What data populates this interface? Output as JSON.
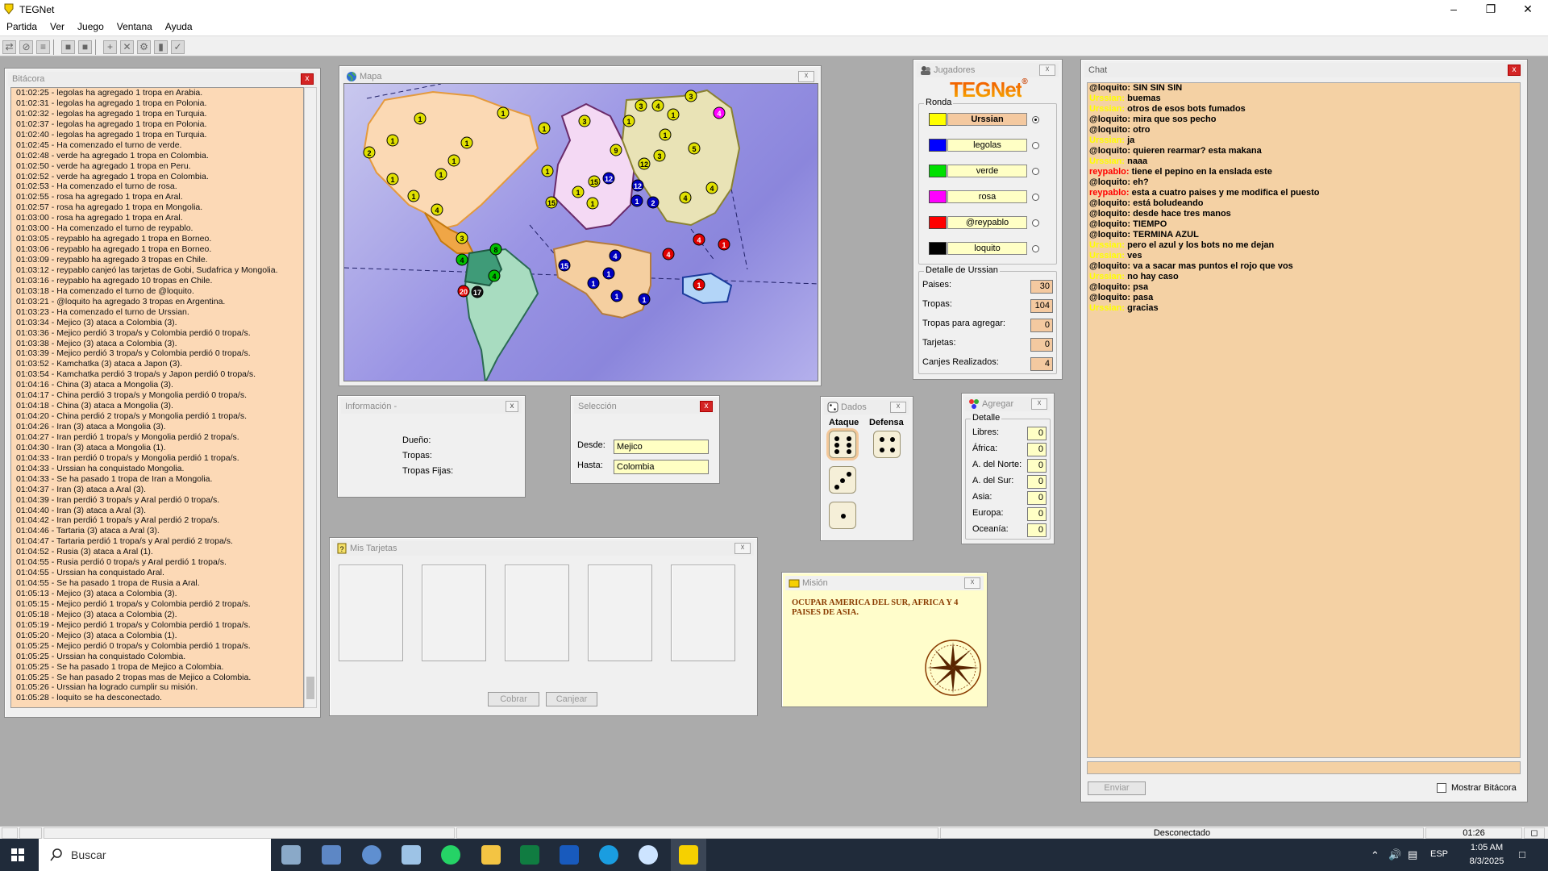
{
  "app": {
    "title": "TEGNet",
    "menu": [
      "Partida",
      "Ver",
      "Juego",
      "Ventana",
      "Ayuda"
    ]
  },
  "bitacora": {
    "title": "Bitácora",
    "lines": [
      "01:02:25 - legolas ha agregado 1 tropa en Arabia.",
      "01:02:31 - legolas ha agregado 1 tropa en Polonia.",
      "01:02:32 - legolas ha agregado 1 tropa en Turquia.",
      "01:02:37 - legolas ha agregado 1 tropa en Polonia.",
      "01:02:40 - legolas ha agregado 1 tropa en Turquia.",
      "01:02:45 - Ha comenzado el turno de verde.",
      "01:02:48 - verde ha agregado 1 tropa en Colombia.",
      "01:02:50 - verde ha agregado 1 tropa en Peru.",
      "01:02:52 - verde ha agregado 1 tropa en Colombia.",
      "01:02:53 - Ha comenzado el turno de rosa.",
      "01:02:55 - rosa ha agregado 1 tropa en Aral.",
      "01:02:57 - rosa ha agregado 1 tropa en Mongolia.",
      "01:03:00 - rosa ha agregado 1 tropa en Aral.",
      "01:03:00 - Ha comenzado el turno de reypablo.",
      "01:03:05 - reypablo ha agregado 1 tropa en Borneo.",
      "01:03:06 - reypablo ha agregado 1 tropa en Borneo.",
      "01:03:09 - reypablo ha agregado 3 tropas en Chile.",
      "01:03:12 - reypablo canjeó las tarjetas de Gobi, Sudafrica y Mongolia.",
      "01:03:16 - reypablo ha agregado 10 tropas en Chile.",
      "01:03:18 - Ha comenzado el turno de @loquito.",
      "01:03:21 - @loquito ha agregado 3 tropas en Argentina.",
      "01:03:23 - Ha comenzado el turno de Urssian.",
      "01:03:34 - Mejico (3) ataca a Colombia (3).",
      "01:03:36 - Mejico perdió 3 tropa/s y Colombia perdió 0 tropa/s.",
      "01:03:38 - Mejico (3) ataca a Colombia (3).",
      "01:03:39 - Mejico perdió 3 tropa/s y Colombia perdió 0 tropa/s.",
      "01:03:52 - Kamchatka (3) ataca a Japon (3).",
      "01:03:54 - Kamchatka perdió 3 tropa/s y Japon perdió 0 tropa/s.",
      "01:04:16 - China (3) ataca a Mongolia (3).",
      "01:04:17 - China perdió 3 tropa/s y Mongolia perdió 0 tropa/s.",
      "01:04:18 - China (3) ataca a Mongolia (3).",
      "01:04:20 - China perdió 2 tropa/s y Mongolia perdió 1 tropa/s.",
      "01:04:26 - Iran (3) ataca a Mongolia (3).",
      "01:04:27 - Iran perdió 1 tropa/s y Mongolia perdió 2 tropa/s.",
      "01:04:30 - Iran (3) ataca a Mongolia (1).",
      "01:04:33 - Iran perdió 0 tropa/s y Mongolia perdió 1 tropa/s.",
      "01:04:33 - Urssian ha conquistado Mongolia.",
      "01:04:33 - Se ha pasado 1 tropa de Iran a Mongolia.",
      "01:04:37 - Iran (3) ataca a Aral (3).",
      "01:04:39 - Iran perdió 3 tropa/s y Aral perdió 0 tropa/s.",
      "01:04:40 - Iran (3) ataca a Aral (3).",
      "01:04:42 - Iran perdió 1 tropa/s y Aral perdió 2 tropa/s.",
      "01:04:46 - Tartaria (3) ataca a Aral (3).",
      "01:04:47 - Tartaria perdió 1 tropa/s y Aral perdió 2 tropa/s.",
      "01:04:52 - Rusia (3) ataca a Aral (1).",
      "01:04:55 - Rusia perdió 0 tropa/s y Aral perdió 1 tropa/s.",
      "01:04:55 - Urssian ha conquistado Aral.",
      "01:04:55 - Se ha pasado 1 tropa de Rusia a Aral.",
      "01:05:13 - Mejico (3) ataca a Colombia (3).",
      "01:05:15 - Mejico perdió 1 tropa/s y Colombia perdió 2 tropa/s.",
      "01:05:18 - Mejico (3) ataca a Colombia (2).",
      "01:05:19 - Mejico perdió 1 tropa/s y Colombia perdió 1 tropa/s.",
      "01:05:20 - Mejico (3) ataca a Colombia (1).",
      "01:05:25 - Mejico perdió 0 tropa/s y Colombia perdió 1 tropa/s.",
      "01:05:25 - Urssian ha conquistado Colombia.",
      "01:05:25 - Se ha pasado 1 tropa de Mejico a Colombia.",
      "01:05:25 - Se han pasado 2 tropas mas de Mejico a Colombia.",
      "01:05:26 - Urssian ha logrado cumplir su misión.",
      "01:05:28 - loquito se ha desconectado."
    ]
  },
  "mapa": {
    "title": "Mapa"
  },
  "informacion": {
    "title": "Información -",
    "duenio": "Dueño:",
    "tropas": "Tropas:",
    "tropas_fijas": "Tropas Fijas:"
  },
  "seleccion": {
    "title": "Selección",
    "desde_label": "Desde:",
    "desde": "Mejico",
    "hasta_label": "Hasta:",
    "hasta": "Colombia"
  },
  "tarjetas": {
    "title": "Mis Tarjetas",
    "cobrar": "Cobrar",
    "canjear": "Canjear"
  },
  "jugadores": {
    "title": "Jugadores",
    "logo": "TEGNet",
    "ronda": "Ronda",
    "players": [
      {
        "name": "Urssian",
        "color": "#ffff00",
        "active": true
      },
      {
        "name": "legolas",
        "color": "#0000ff"
      },
      {
        "name": "verde",
        "color": "#00e000"
      },
      {
        "name": "rosa",
        "color": "#ff00ff"
      },
      {
        "name": "@reypablo",
        "color": "#ff0000"
      },
      {
        "name": "loquito",
        "color": "#000000"
      }
    ],
    "detalle_title": "Detalle de Urssian",
    "paises_label": "Paises:",
    "paises": "30",
    "tropas_label": "Tropas:",
    "tropas": "104",
    "agregar_label": "Tropas para agregar:",
    "agregar": "0",
    "tarjetas_label": "Tarjetas:",
    "tarjetas": "0",
    "canjes_label": "Canjes Realizados:",
    "canjes": "4"
  },
  "dados": {
    "title": "Dados",
    "ataque": "Ataque",
    "defensa": "Defensa"
  },
  "agregar": {
    "title": "Agregar",
    "detalle": "Detalle",
    "rows": [
      {
        "label": "Libres:",
        "value": "0"
      },
      {
        "label": "África:",
        "value": "0"
      },
      {
        "label": "A. del Norte:",
        "value": "0"
      },
      {
        "label": "A. del Sur:",
        "value": "0"
      },
      {
        "label": "Asia:",
        "value": "0"
      },
      {
        "label": "Europa:",
        "value": "0"
      },
      {
        "label": "Oceanía:",
        "value": "0"
      }
    ]
  },
  "mision": {
    "title": "Misión",
    "text": "OCUPAR AMERICA DEL SUR, AFRICA Y 4 PAISES DE ASIA."
  },
  "chat": {
    "title": "Chat",
    "enviar": "Enviar",
    "mostrar": "Mostrar Bitácora",
    "messages": [
      {
        "user": "@loquito:",
        "text": "SIN SIN SIN",
        "color": "#000000"
      },
      {
        "user": "Urssian:",
        "text": "buemas",
        "color": "#ffff00"
      },
      {
        "user": "Urssian:",
        "text": "otros de esos bots fumados",
        "color": "#ffff00"
      },
      {
        "user": "@loquito:",
        "text": "mira que sos pecho",
        "color": "#000000"
      },
      {
        "user": "@loquito:",
        "text": "otro",
        "color": "#000000"
      },
      {
        "user": "Urssian:",
        "text": "ja",
        "color": "#ffff00"
      },
      {
        "user": "@loquito:",
        "text": "quieren rearmar? esta makana",
        "color": "#000000"
      },
      {
        "user": "Urssian:",
        "text": "naaa",
        "color": "#ffff00"
      },
      {
        "user": "reypablo:",
        "text": "tiene el pepino en la enslada este",
        "color": "#ff0000"
      },
      {
        "user": "@loquito:",
        "text": "eh?",
        "color": "#000000"
      },
      {
        "user": "reypablo:",
        "text": "esta a cuatro  paises y me modifica el puesto",
        "color": "#ff0000"
      },
      {
        "user": "@loquito:",
        "text": "está boludeando",
        "color": "#000000"
      },
      {
        "user": "@loquito:",
        "text": "desde hace tres manos",
        "color": "#000000"
      },
      {
        "user": "@loquito:",
        "text": "TIEMPO",
        "color": "#000000"
      },
      {
        "user": "@loquito:",
        "text": "TERMINA AZUL",
        "color": "#000000"
      },
      {
        "user": "Urssian:",
        "text": "pero el azul y los bots no me dejan",
        "color": "#ffff00"
      },
      {
        "user": "Urssian:",
        "text": "ves",
        "color": "#ffff00"
      },
      {
        "user": "@loquito:",
        "text": "va a sacar mas puntos el rojo que vos",
        "color": "#000000"
      },
      {
        "user": "Urssian:",
        "text": "no hay caso",
        "color": "#ffff00"
      },
      {
        "user": "@loquito:",
        "text": "psa",
        "color": "#000000"
      },
      {
        "user": "@loquito:",
        "text": "pasa",
        "color": "#000000"
      },
      {
        "user": "Urssian:",
        "text": "gracias",
        "color": "#ffff00"
      }
    ]
  },
  "status": {
    "conn": "Desconectado",
    "time": "01:26"
  },
  "taskbar": {
    "search": "Buscar",
    "lang": "ESP",
    "clock": "1:05 AM",
    "date": "8/3/2025"
  }
}
